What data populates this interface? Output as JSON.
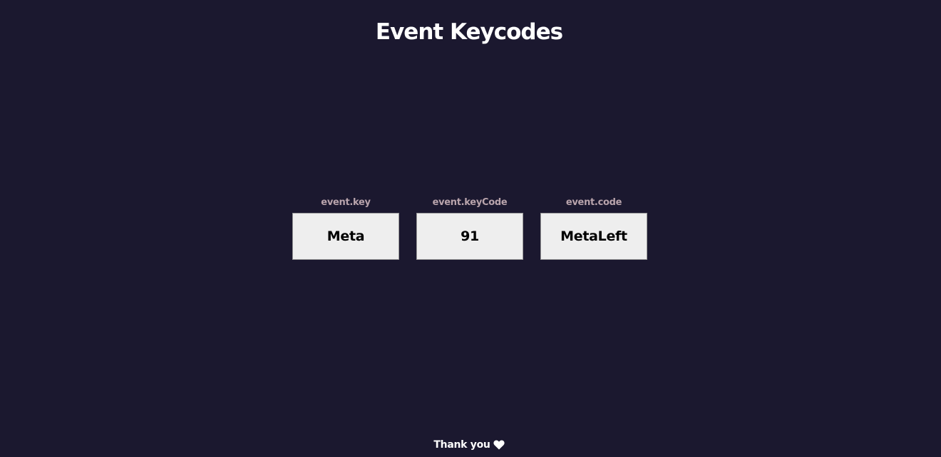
{
  "title": "Event Keycodes",
  "keys": [
    {
      "label": "event.key",
      "value": "Meta"
    },
    {
      "label": "event.keyCode",
      "value": "91"
    },
    {
      "label": "event.code",
      "value": "MetaLeft"
    }
  ],
  "footer": {
    "text": "Thank you",
    "icon": "heart-icon"
  },
  "colors": {
    "background": "#1b182f",
    "label": "#b9a4ac",
    "box": "#eeeeee",
    "text": "#ffffff"
  }
}
